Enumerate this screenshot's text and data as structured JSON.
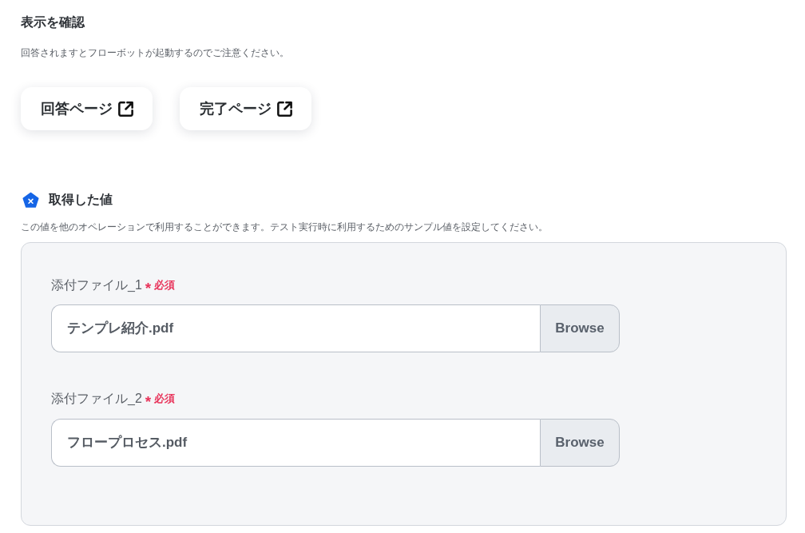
{
  "preview": {
    "title": "表示を確認",
    "description": "回答されますとフローボットが起動するのでご注意ください。",
    "buttons": [
      "回答ページ",
      "完了ページ"
    ]
  },
  "outputs": {
    "title": "取得した値",
    "description": "この値を他のオペレーションで利用することができます。テスト実行時に利用するためのサンプル値を設定してください。",
    "fields": [
      {
        "label": "添付ファイル_1",
        "required_mark": "*",
        "required_label": "必須",
        "value": "テンプレ紹介.pdf",
        "button": "Browse"
      },
      {
        "label": "添付ファイル_2",
        "required_mark": "*",
        "required_label": "必須",
        "value": "フロープロセス.pdf",
        "button": "Browse"
      }
    ]
  }
}
